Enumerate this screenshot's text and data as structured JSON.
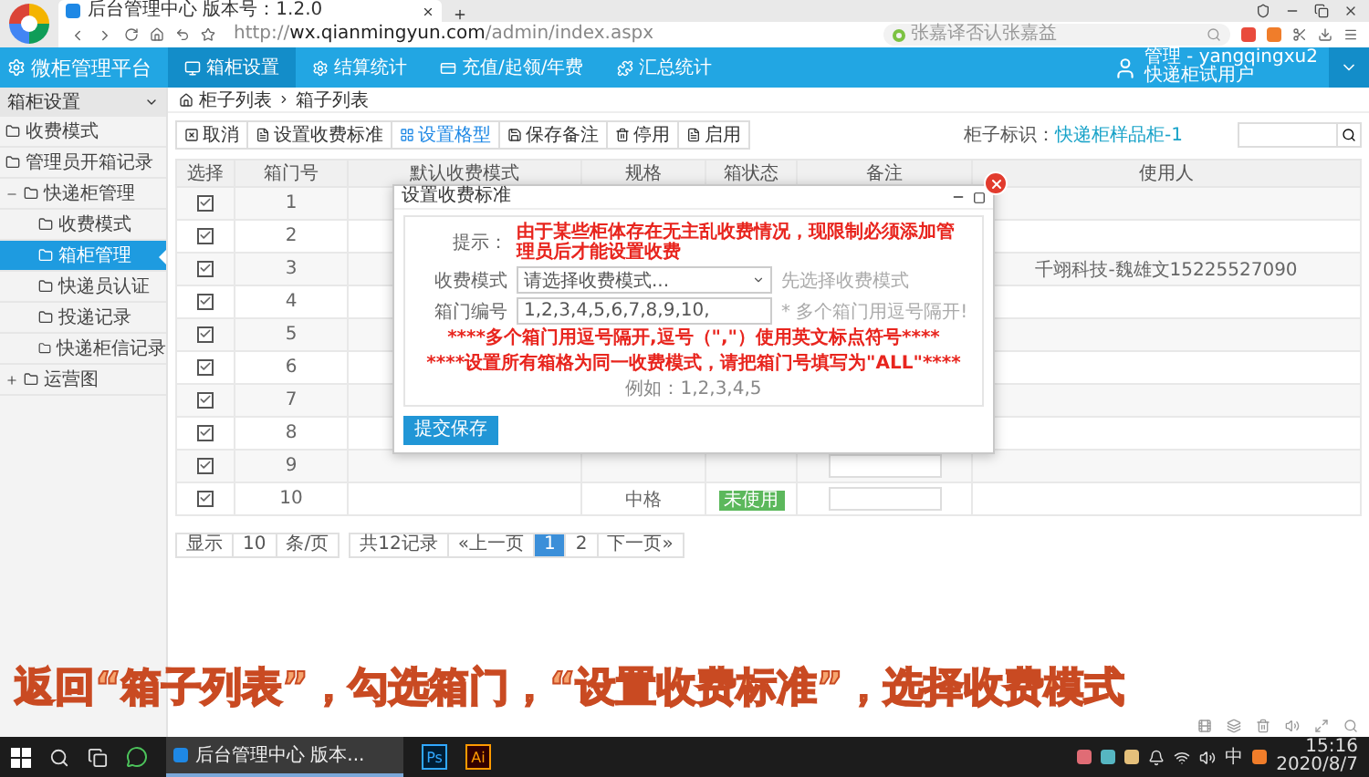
{
  "browser": {
    "tab_title": "后台管理中心 版本号：1.2.0",
    "url": "http://**wx.qianmingyun.com**/admin/index.aspx",
    "search_placeholder": "张嘉译否认张嘉益"
  },
  "app": {
    "logo": "微柜管理平台",
    "nav": [
      {
        "label": "箱柜设置",
        "selected": true
      },
      {
        "label": "结算统计",
        "selected": false
      },
      {
        "label": "充值/起领/年费",
        "selected": false
      },
      {
        "label": "汇总统计",
        "selected": false
      }
    ],
    "user": {
      "name": "管理 - yangqingxu2",
      "role": "快递柜试用户"
    }
  },
  "sidebar": {
    "title": "箱柜设置",
    "items": [
      {
        "kind": "link",
        "label": "收费模式",
        "selected": false
      },
      {
        "kind": "link",
        "label": "管理员开箱记录",
        "selected": false
      },
      {
        "kind": "group",
        "label": "快递柜管理",
        "expanded": true,
        "children": [
          {
            "kind": "link",
            "label": "收费模式",
            "selected": false
          },
          {
            "kind": "link",
            "label": "箱柜管理",
            "selected": true
          },
          {
            "kind": "link",
            "label": "快递员认证",
            "selected": false
          },
          {
            "kind": "link",
            "label": "投递记录",
            "selected": false
          },
          {
            "kind": "link",
            "label": "快递柜信记录",
            "selected": false
          }
        ]
      },
      {
        "kind": "group",
        "label": "运营图",
        "expanded": false
      }
    ]
  },
  "breadcrumb": [
    "柜子列表",
    "箱子列表"
  ],
  "toolbar": [
    {
      "label": "取消",
      "selected": false
    },
    {
      "label": "设置收费标准",
      "selected": false
    },
    {
      "label": "设置格型",
      "selected": true
    },
    {
      "label": "保存备注",
      "selected": false
    },
    {
      "label": "停用",
      "selected": false
    },
    {
      "label": "启用",
      "selected": false
    }
  ],
  "cabinet": {
    "label": "柜子标识：",
    "value": "快递柜样品柜-1"
  },
  "table": {
    "columns": [
      "选择",
      "箱门号",
      "默认收费模式",
      "规格",
      "箱状态",
      "备注",
      "使用人"
    ],
    "rows": [
      {
        "checked": true,
        "door": "1"
      },
      {
        "checked": true,
        "door": "2"
      },
      {
        "checked": true,
        "door": "3",
        "user": "千翊科技-魏雄文15225527090"
      },
      {
        "checked": true,
        "door": "4"
      },
      {
        "checked": true,
        "door": "5"
      },
      {
        "checked": true,
        "door": "6"
      },
      {
        "checked": true,
        "door": "7"
      },
      {
        "checked": true,
        "door": "8"
      },
      {
        "checked": true,
        "door": "9"
      },
      {
        "checked": true,
        "door": "10",
        "spec": "中格",
        "status": "未使用"
      }
    ]
  },
  "pagination": {
    "show": "显示",
    "per_page": "10",
    "unit": "条/页",
    "total": "共12记录",
    "prev": "«上一页",
    "pages": [
      {
        "label": "1",
        "selected": true
      },
      {
        "label": "2",
        "selected": false
      }
    ],
    "next": "下一页»"
  },
  "modal": {
    "title": "设置收费标准",
    "tip_label": "提示：",
    "tip": "由于某些柜体存在无主乱收费情况，现限制必须添加管理员后才能设置收费",
    "fields": [
      {
        "kind": "select",
        "label": "收费模式",
        "value": "请选择收费模式...",
        "hint": "先选择收费模式"
      },
      {
        "kind": "input",
        "label": "箱门编号",
        "value": "1,2,3,4,5,6,7,8,9,10,",
        "hint": "* 多个箱门用逗号隔开!"
      }
    ],
    "notes": [
      "****多个箱门用逗号隔开,逗号（\",\"）使用英文标点符号****",
      "****设置所有箱格为同一收费模式，请把箱门号填写为\"ALL\"****"
    ],
    "example": "例如：1,2,3,4,5",
    "submit": "提交保存"
  },
  "caption": "返回“箱子列表”，勾选箱门，“设置收费标准”，选择收费模式",
  "taskbar": {
    "task": "后台管理中心 版本...",
    "apps": [
      "Ps",
      "Ai"
    ],
    "ime": "中",
    "time": "15:16",
    "date": "2020/8/7"
  }
}
